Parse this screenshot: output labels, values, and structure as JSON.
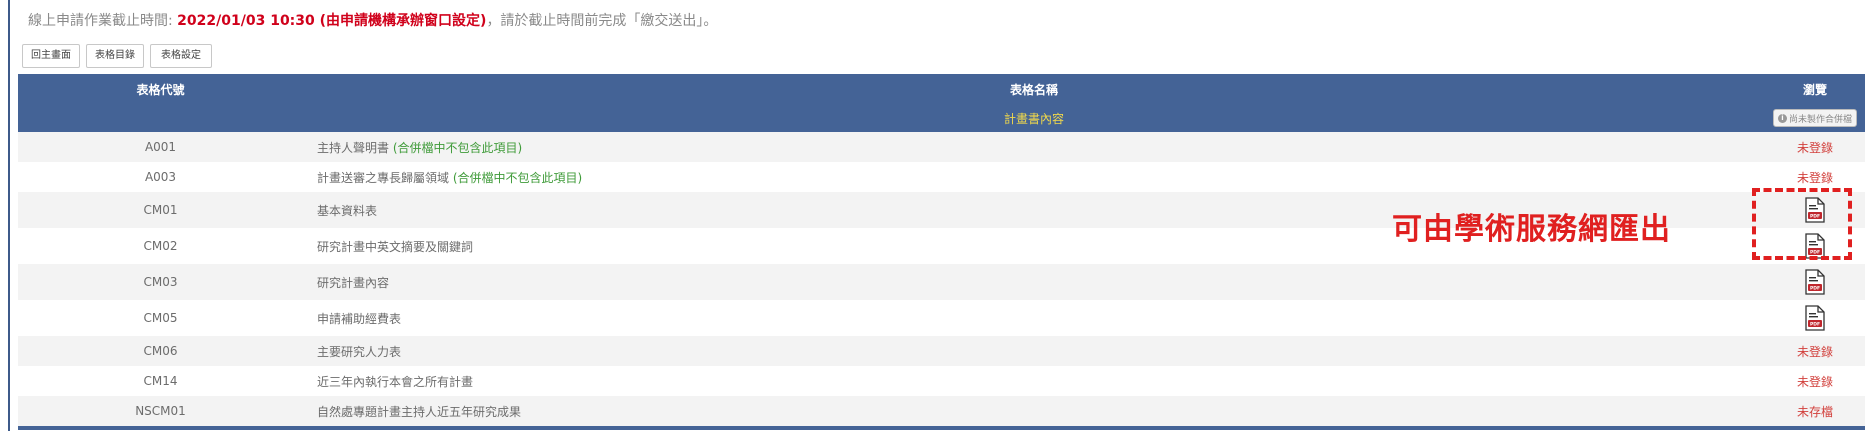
{
  "notice": {
    "prefix": "線上申請作業截止時間: ",
    "deadline": "2022/01/03 10:30 (由申請機構承辦窗口設定)",
    "suffix": "，請於截止時間前完成「繳交送出」。"
  },
  "buttons": {
    "home": "回主畫面",
    "form_list": "表格目錄",
    "form_settings": "表格設定"
  },
  "table": {
    "headers": {
      "code": "表格代號",
      "name": "表格名稱",
      "view": "瀏覽"
    },
    "section_title": "計畫書內容",
    "merge_button": "尚未製作合併檔",
    "rows": [
      {
        "code": "A001",
        "name": "主持人聲明書",
        "note": " (合併檔中不包含此項目)",
        "status": "未登錄"
      },
      {
        "code": "A003",
        "name": "計畫送審之專長歸屬領域",
        "note": " (合併檔中不包含此項目)",
        "status": "未登錄"
      },
      {
        "code": "CM01",
        "name": "基本資料表",
        "note": "",
        "status": "",
        "icon": "pdf-icon"
      },
      {
        "code": "CM02",
        "name": "研究計畫中英文摘要及關鍵詞",
        "note": "",
        "status": "",
        "icon": "pdf-icon"
      },
      {
        "code": "CM03",
        "name": "研究計畫內容",
        "note": "",
        "status": "",
        "icon": "pdf-icon"
      },
      {
        "code": "CM05",
        "name": "申請補助經費表",
        "note": "",
        "status": "",
        "icon": "pdf-icon"
      },
      {
        "code": "CM06",
        "name": "主要研究人力表",
        "note": "",
        "status": "未登錄"
      },
      {
        "code": "CM14",
        "name": "近三年內執行本會之所有計畫",
        "note": "",
        "status": "未登錄"
      },
      {
        "code": "NSCM01",
        "name": "自然處專題計畫主持人近五年研究成果",
        "note": "",
        "status": "未存檔"
      }
    ]
  },
  "annotation": {
    "text": "可由學術服務網匯出"
  },
  "colors": {
    "header_bg": "#446396",
    "section_title": "#f1d84b",
    "status_red": "#d2403c",
    "note_green": "#3f9b39",
    "annotation_red": "#e02020"
  }
}
